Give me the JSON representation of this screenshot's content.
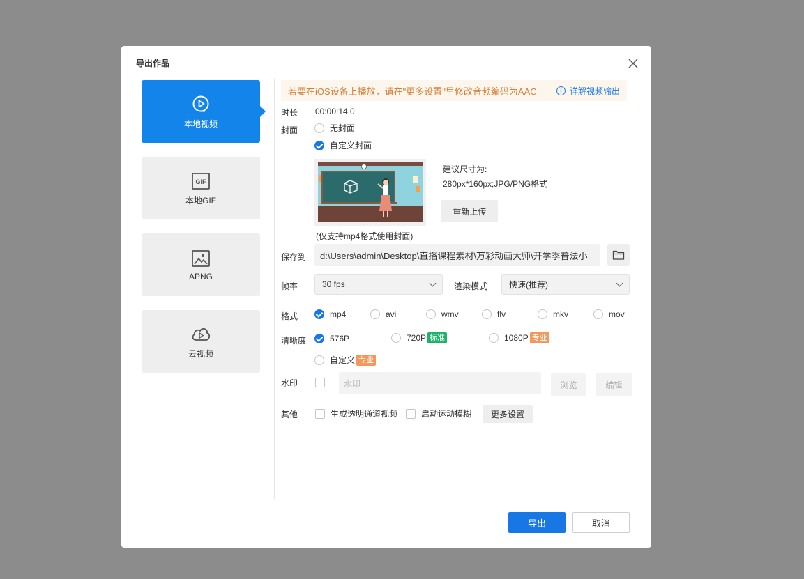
{
  "dialog": {
    "title": "导出作品"
  },
  "tabs": [
    {
      "label": "本地视频",
      "icon": "play-circle-icon",
      "active": true
    },
    {
      "label": "本地GIF",
      "icon": "gif-icon",
      "active": false
    },
    {
      "label": "APNG",
      "icon": "image-icon",
      "active": false
    },
    {
      "label": "云视频",
      "icon": "cloud-play-icon",
      "active": false
    }
  ],
  "notice": {
    "text": "若要在iOS设备上播放，请在\"更多设置\"里修改音频编码为AAC",
    "link": "详解视频输出",
    "icon": "info-icon"
  },
  "duration": {
    "label": "时长",
    "value": "00:00:14.0"
  },
  "cover": {
    "label": "封面",
    "options": [
      "无封面",
      "自定义封面"
    ],
    "selected": "自定义封面",
    "hint_line1": "建议尺寸为:",
    "hint_line2": "280px*160px;JPG/PNG格式",
    "reupload": "重新上传",
    "note": "(仅支持mp4格式使用封面)"
  },
  "save_to": {
    "label": "保存到",
    "path": "d:\\Users\\admin\\Desktop\\直播课程素材\\万彩动画大师\\开学季普法小",
    "icon": "folder-icon"
  },
  "fps": {
    "label": "帧率",
    "value": "30 fps"
  },
  "render_mode": {
    "label": "渲染模式",
    "value": "快速(推荐)"
  },
  "format": {
    "label": "格式",
    "options": [
      "mp4",
      "avi",
      "wmv",
      "flv",
      "mkv",
      "mov"
    ],
    "selected": "mp4"
  },
  "resolution": {
    "label": "清晰度",
    "options": [
      "576P",
      "720P",
      "1080P",
      "自定义"
    ],
    "selected": "576P",
    "badges": {
      "standard": "标准",
      "pro": "专业"
    }
  },
  "watermark": {
    "label": "水印",
    "placeholder": "水印",
    "browse": "浏览",
    "edit": "编辑"
  },
  "other": {
    "label": "其他",
    "alpha": "生成透明通道视频",
    "motion_blur": "启动运动模糊",
    "more_settings": "更多设置"
  },
  "footer": {
    "export": "导出",
    "cancel": "取消"
  },
  "colors": {
    "primary": "#1677e5",
    "tab_active": "#1385ea",
    "notice_text": "#d4803a",
    "notice_bg": "#fdf6ec",
    "badge_green": "#1fb36a",
    "badge_orange": "#f5965a"
  }
}
